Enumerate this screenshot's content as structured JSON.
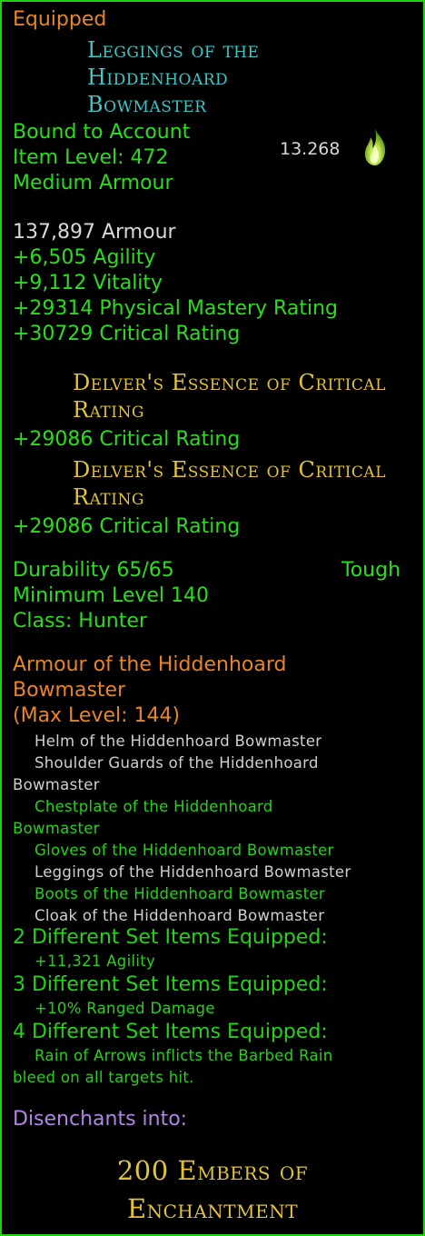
{
  "header": {
    "status": "Equipped",
    "item_name_lines": [
      "Leggings of the",
      "Hiddenhoard",
      "Bowmaster"
    ],
    "binding": "Bound to Account",
    "item_level": "Item Level: 472",
    "armour_type": "Medium Armour",
    "value": "13.268",
    "value_icon": "flame-icon"
  },
  "stats": [
    "137,897 Armour",
    "+6,505 Agility",
    "+9,112 Vitality",
    "+29314 Physical Mastery Rating",
    "+30729 Critical Rating"
  ],
  "essences": [
    {
      "name_lines": [
        "Delver's Essence of Critical",
        "Rating"
      ],
      "bonus": "+29086 Critical Rating"
    },
    {
      "name_lines": [
        "Delver's Essence of Critical",
        "Rating"
      ],
      "bonus": "+29086 Critical Rating"
    }
  ],
  "requirements": {
    "durability": "Durability 65/65",
    "quality": "Tough",
    "min_level": "Minimum Level 140",
    "class_label": "Class:",
    "class_value": "Hunter"
  },
  "set": {
    "name_lines": [
      "Armour of the Hiddenhoard",
      "Bowmaster"
    ],
    "max_level": "(Max Level: 144)",
    "pieces": [
      {
        "lines": [
          "Helm of the Hiddenhoard Bowmaster"
        ],
        "equipped": false
      },
      {
        "lines": [
          "Shoulder Guards of the Hiddenhoard",
          "Bowmaster"
        ],
        "equipped": false
      },
      {
        "lines": [
          "Chestplate of the Hiddenhoard",
          "Bowmaster"
        ],
        "equipped": true
      },
      {
        "lines": [
          "Gloves of the Hiddenhoard Bowmaster"
        ],
        "equipped": true
      },
      {
        "lines": [
          "Leggings of the Hiddenhoard Bowmaster"
        ],
        "equipped": false
      },
      {
        "lines": [
          "Boots of the Hiddenhoard Bowmaster"
        ],
        "equipped": true
      },
      {
        "lines": [
          "Cloak of the Hiddenhoard Bowmaster"
        ],
        "equipped": false
      }
    ],
    "bonuses": [
      {
        "label": "2 Different Set Items Equipped:",
        "effect_lines": [
          "+11,321 Agility"
        ]
      },
      {
        "label": "3 Different Set Items Equipped:",
        "effect_lines": [
          "+10% Ranged Damage"
        ]
      },
      {
        "label": "4 Different Set Items Equipped:",
        "effect_lines": [
          "Rain of Arrows inflicts the Barbed Rain",
          "bleed on all targets hit."
        ]
      }
    ]
  },
  "disenchant": {
    "label": "Disenchants into:",
    "result_lines": [
      "200 Embers of",
      "Enchantment"
    ]
  },
  "colors": {
    "border": "#1bd40f",
    "status_orange": "#e8842c",
    "name_teal": "#3ec7c7",
    "stat_green": "#2ddc1f",
    "essence_gold": "#e2c23a",
    "disenchant_purple": "#b184e8"
  }
}
